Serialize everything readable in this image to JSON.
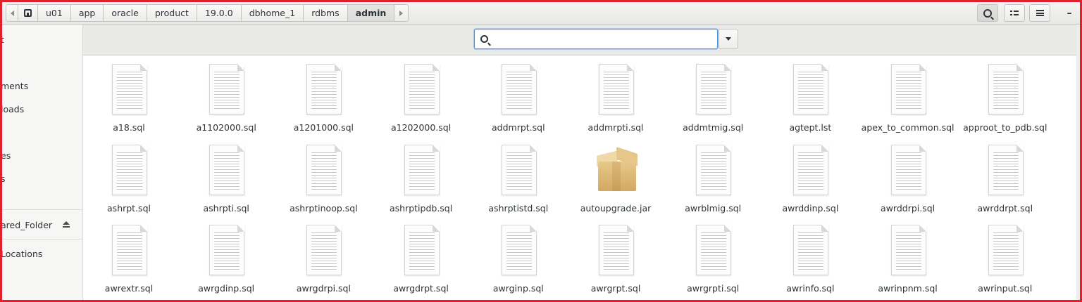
{
  "pathbar": {
    "crumbs": [
      "u01",
      "app",
      "oracle",
      "product",
      "19.0.0",
      "dbhome_1",
      "rdbms",
      "admin"
    ]
  },
  "icons": {
    "back": "chevron-left-icon",
    "forward": "chevron-right-icon",
    "home": "home-icon",
    "search": "search-icon",
    "view": "list-view-icon",
    "menu": "hamburger-menu-icon",
    "minimize": "minimize-icon",
    "eject": "eject-icon",
    "file": "text-file-icon",
    "archive": "package-icon"
  },
  "window": {
    "minimize_label": "–"
  },
  "sidebar": {
    "items": [
      "t",
      "ments",
      "loads",
      "es",
      "s",
      "ared_Folder",
      " Locations"
    ]
  },
  "search": {
    "value": "",
    "placeholder": ""
  },
  "files": [
    {
      "name": "a18.sql",
      "type": "text"
    },
    {
      "name": "a1102000.sql",
      "type": "text"
    },
    {
      "name": "a1201000.sql",
      "type": "text"
    },
    {
      "name": "a1202000.sql",
      "type": "text"
    },
    {
      "name": "addmrpt.sql",
      "type": "text"
    },
    {
      "name": "addmrpti.sql",
      "type": "text"
    },
    {
      "name": "addmtmig.sql",
      "type": "text"
    },
    {
      "name": "agtept.lst",
      "type": "text"
    },
    {
      "name": "apex_to_common.sql",
      "type": "text"
    },
    {
      "name": "approot_to_pdb.sql",
      "type": "text"
    },
    {
      "name": "ashrpt.sql",
      "type": "text"
    },
    {
      "name": "ashrpti.sql",
      "type": "text"
    },
    {
      "name": "ashrptinoop.sql",
      "type": "text"
    },
    {
      "name": "ashrptipdb.sql",
      "type": "text"
    },
    {
      "name": "ashrptistd.sql",
      "type": "text"
    },
    {
      "name": "autoupgrade.jar",
      "type": "archive"
    },
    {
      "name": "awrblmig.sql",
      "type": "text"
    },
    {
      "name": "awrddinp.sql",
      "type": "text"
    },
    {
      "name": "awrddrpi.sql",
      "type": "text"
    },
    {
      "name": "awrddrpt.sql",
      "type": "text"
    },
    {
      "name": "awrextr.sql",
      "type": "text"
    },
    {
      "name": "awrgdinp.sql",
      "type": "text"
    },
    {
      "name": "awrgdrpi.sql",
      "type": "text"
    },
    {
      "name": "awrgdrpt.sql",
      "type": "text"
    },
    {
      "name": "awrginp.sql",
      "type": "text"
    },
    {
      "name": "awrgrpt.sql",
      "type": "text"
    },
    {
      "name": "awrgrpti.sql",
      "type": "text"
    },
    {
      "name": "awrinfo.sql",
      "type": "text"
    },
    {
      "name": "awrinpnm.sql",
      "type": "text"
    },
    {
      "name": "awrinput.sql",
      "type": "text"
    }
  ]
}
